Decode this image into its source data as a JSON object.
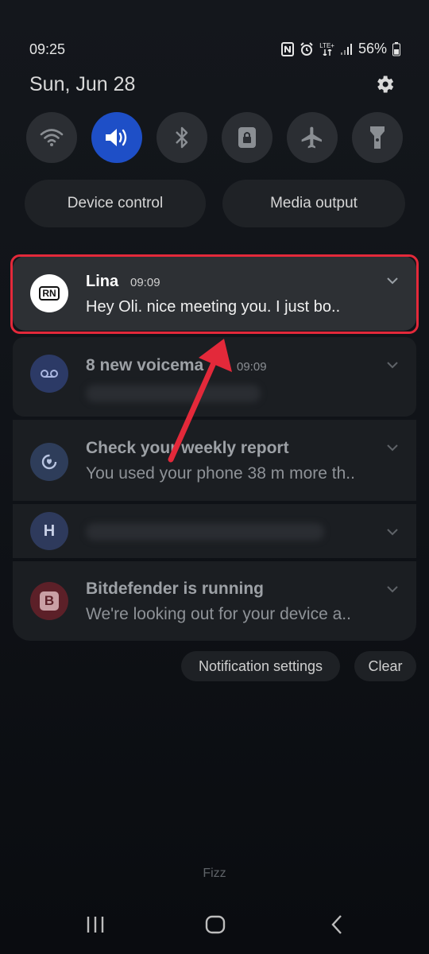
{
  "status_bar": {
    "time": "09:25",
    "network_label": "LTE+",
    "battery": "56%"
  },
  "header": {
    "date": "Sun, Jun 28",
    "settings_icon": "gear-icon"
  },
  "quick_toggles": [
    {
      "name": "Wi-Fi",
      "icon": "wifi-icon",
      "active": false
    },
    {
      "name": "Sound",
      "icon": "sound-icon",
      "active": true
    },
    {
      "name": "Bluetooth",
      "icon": "bluetooth-icon",
      "active": false
    },
    {
      "name": "Rotation lock",
      "icon": "lock-icon",
      "active": false
    },
    {
      "name": "Airplane mode",
      "icon": "airplane-icon",
      "active": false
    },
    {
      "name": "Flashlight",
      "icon": "flashlight-icon",
      "active": false
    }
  ],
  "pills": {
    "device_control": "Device control",
    "media_output": "Media output"
  },
  "notifications": {
    "lina": {
      "icon_text": "RN",
      "title": "Lina",
      "time": "09:09",
      "text": "Hey Oli. nice meeting you.  I just bo.."
    },
    "voicemail": {
      "title": "8 new voicema",
      "time": "09:09"
    },
    "report": {
      "title": "Check your weekly report",
      "text": "You used your phone 38 m more th.."
    },
    "hidden": {
      "icon_text": "H"
    },
    "bitdefender": {
      "icon_text": "B",
      "title": "Bitdefender is running",
      "text": "We're looking out for your device a.."
    }
  },
  "actions": {
    "notification_settings": "Notification settings",
    "clear": "Clear"
  },
  "carrier": "Fizz",
  "colors": {
    "accent": "#1e4fc7",
    "highlight": "#e3293a"
  }
}
